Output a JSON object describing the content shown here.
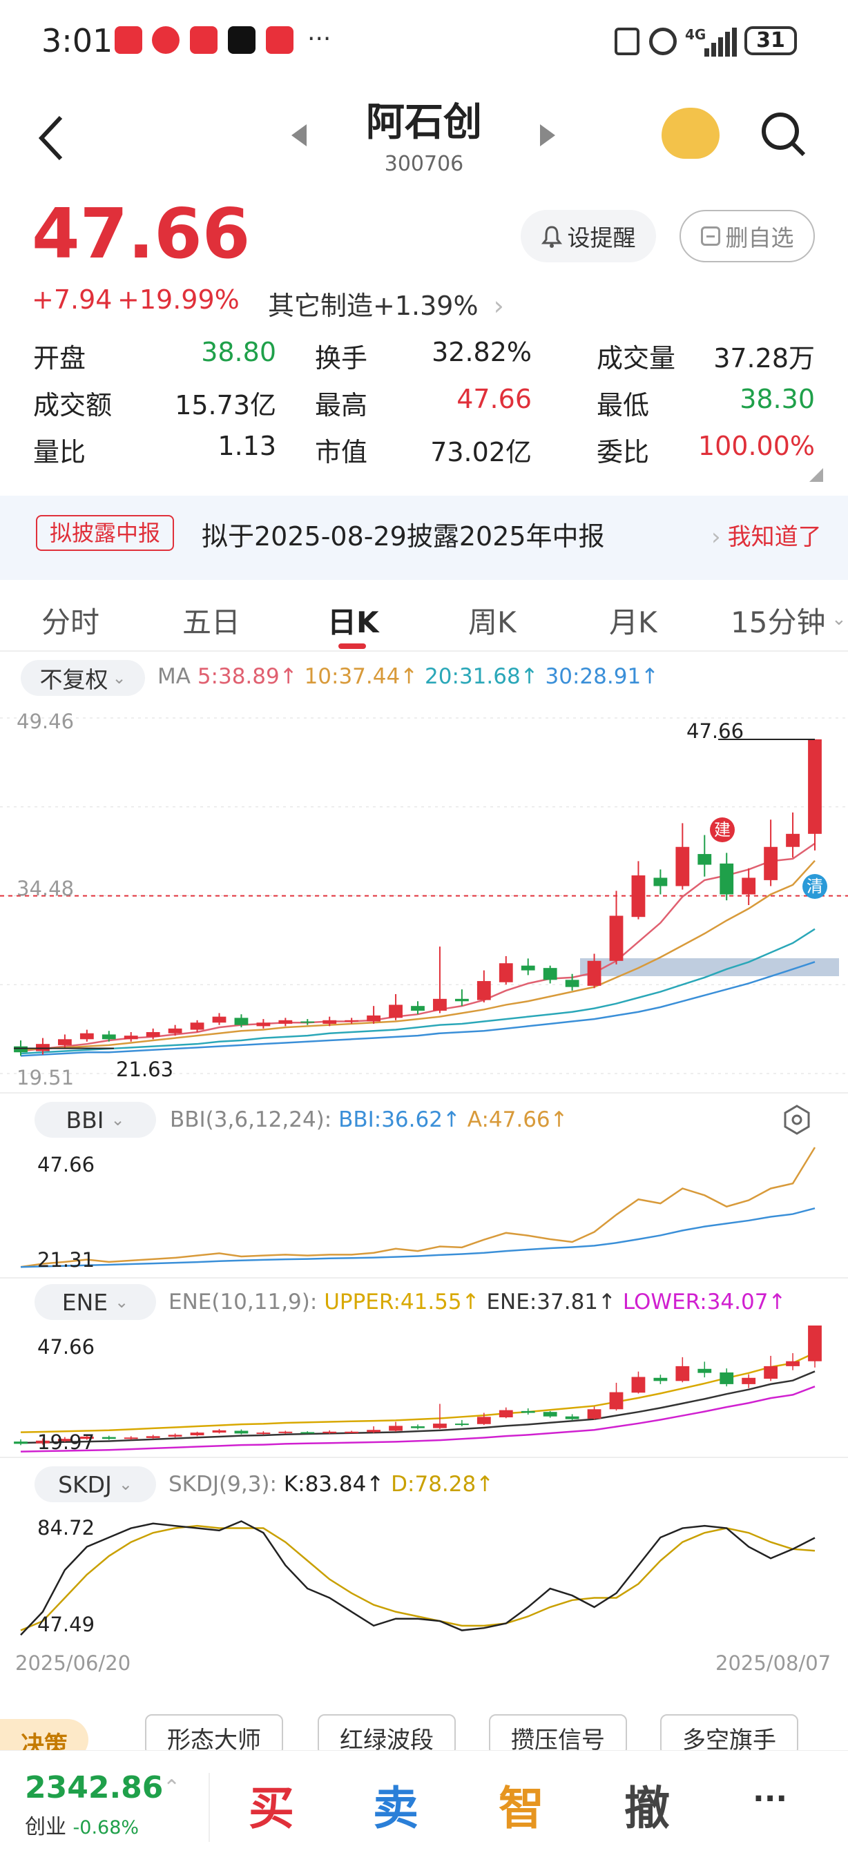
{
  "status_bar": {
    "time": "3:01",
    "battery": "31",
    "network": "4G"
  },
  "header": {
    "title": "阿石创",
    "code": "300706"
  },
  "quote": {
    "price": "47.66",
    "change": "+7.94",
    "change_pct": "+19.99%",
    "sector": "其它制造+1.39%",
    "alert_label": "设提醒",
    "remove_label": "删自选"
  },
  "stats": [
    {
      "label": "开盘",
      "value": "38.80",
      "color": "green"
    },
    {
      "label": "换手",
      "value": "32.82%",
      "color": "black"
    },
    {
      "label": "成交量",
      "value": "37.28万",
      "color": "black"
    },
    {
      "label": "成交额",
      "value": "15.73亿",
      "color": "black"
    },
    {
      "label": "最高",
      "value": "47.66",
      "color": "red"
    },
    {
      "label": "最低",
      "value": "38.30",
      "color": "green"
    },
    {
      "label": "量比",
      "value": "1.13",
      "color": "black"
    },
    {
      "label": "市值",
      "value": "73.02亿",
      "color": "black"
    },
    {
      "label": "委比",
      "value": "100.00%",
      "color": "red"
    }
  ],
  "notice": {
    "badge": "拟披露中报",
    "text": "拟于2025-08-29披露2025年中报",
    "action": "我知道了"
  },
  "tabs": [
    "分时",
    "五日",
    "日K",
    "周K",
    "月K",
    "15分钟"
  ],
  "active_tab": "日K",
  "kline": {
    "adjust": "不复权",
    "ma_label": "MA",
    "ma5": "5:38.89↑",
    "ma10": "10:37.44↑",
    "ma20": "20:31.68↑",
    "ma30": "30:28.91↑",
    "y_top": "49.46",
    "y_mid": "34.48",
    "y_bottom": "19.51",
    "max_label": "47.66",
    "min_label": "21.63",
    "marker_jian": "建",
    "marker_qing": "清"
  },
  "bbi": {
    "name": "BBI",
    "params": "BBI(3,6,12,24):",
    "bbi": "BBI:36.62↑",
    "a": "A:47.66↑",
    "y_top": "47.66",
    "y_bottom": "21.31"
  },
  "ene": {
    "name": "ENE",
    "params": "ENE(10,11,9):",
    "upper": "UPPER:41.55↑",
    "ene": "ENE:37.81↑",
    "lower": "LOWER:34.07↑",
    "y_top": "47.66",
    "y_bottom": "19.97"
  },
  "skdj": {
    "name": "SKDJ",
    "params": "SKDJ(9,3):",
    "k": "K:83.84↑",
    "d": "D:78.28↑",
    "y_top": "84.72",
    "y_bottom": "47.49"
  },
  "dates": {
    "start": "2025/06/20",
    "end": "2025/08/07"
  },
  "chips": [
    "决策",
    "形态大师",
    "红绿波段",
    "攒压信号",
    "多空旗手"
  ],
  "bottom_bar": {
    "index_value": "2342.86",
    "index_name": "创业",
    "index_change": "-0.68%",
    "buy": "买",
    "sell": "卖",
    "smart": "智",
    "cancel": "撤",
    "more": "···"
  },
  "colors": {
    "up": "#e0303a",
    "down": "#1fa04a",
    "ma5": "#e06070",
    "ma10": "#d89a3a",
    "ma20": "#2aa7b8",
    "ma30": "#3a8fd8"
  },
  "chart_data": {
    "type": "candlestick",
    "x_start": "2025/06/20",
    "x_end": "2025/08/07",
    "ylim": [
      19.51,
      49.46
    ],
    "candles": [
      {
        "o": 21.8,
        "c": 21.3,
        "h": 22.3,
        "l": 21.0
      },
      {
        "o": 21.4,
        "c": 22.0,
        "h": 22.5,
        "l": 21.1
      },
      {
        "o": 21.9,
        "c": 22.4,
        "h": 22.8,
        "l": 21.7
      },
      {
        "o": 22.4,
        "c": 22.9,
        "h": 23.2,
        "l": 22.2
      },
      {
        "o": 22.8,
        "c": 22.4,
        "h": 23.1,
        "l": 22.2
      },
      {
        "o": 22.4,
        "c": 22.7,
        "h": 23.0,
        "l": 22.2
      },
      {
        "o": 22.6,
        "c": 23.0,
        "h": 23.3,
        "l": 22.4
      },
      {
        "o": 22.9,
        "c": 23.3,
        "h": 23.6,
        "l": 22.7
      },
      {
        "o": 23.2,
        "c": 23.8,
        "h": 24.0,
        "l": 23.0
      },
      {
        "o": 23.8,
        "c": 24.3,
        "h": 24.6,
        "l": 23.6
      },
      {
        "o": 24.2,
        "c": 23.6,
        "h": 24.5,
        "l": 23.4
      },
      {
        "o": 23.5,
        "c": 23.8,
        "h": 24.1,
        "l": 23.3
      },
      {
        "o": 23.7,
        "c": 24.0,
        "h": 24.2,
        "l": 23.5
      },
      {
        "o": 23.9,
        "c": 23.8,
        "h": 24.1,
        "l": 23.6
      },
      {
        "o": 23.7,
        "c": 24.0,
        "h": 24.3,
        "l": 23.5
      },
      {
        "o": 23.9,
        "c": 24.0,
        "h": 24.2,
        "l": 23.7
      },
      {
        "o": 23.9,
        "c": 24.4,
        "h": 25.2,
        "l": 23.7
      },
      {
        "o": 24.2,
        "c": 25.3,
        "h": 26.2,
        "l": 24.0
      },
      {
        "o": 25.2,
        "c": 24.8,
        "h": 25.6,
        "l": 24.5
      },
      {
        "o": 24.8,
        "c": 25.8,
        "h": 30.2,
        "l": 24.6
      },
      {
        "o": 25.8,
        "c": 25.6,
        "h": 26.6,
        "l": 25.2
      },
      {
        "o": 25.7,
        "c": 27.3,
        "h": 28.2,
        "l": 25.5
      },
      {
        "o": 27.2,
        "c": 28.8,
        "h": 29.4,
        "l": 27.0
      },
      {
        "o": 28.6,
        "c": 28.2,
        "h": 29.2,
        "l": 27.8
      },
      {
        "o": 28.4,
        "c": 27.4,
        "h": 28.6,
        "l": 27.1
      },
      {
        "o": 27.4,
        "c": 26.8,
        "h": 27.9,
        "l": 26.5
      },
      {
        "o": 26.9,
        "c": 29.0,
        "h": 29.6,
        "l": 26.7
      },
      {
        "o": 29.0,
        "c": 32.8,
        "h": 34.9,
        "l": 28.7
      },
      {
        "o": 32.7,
        "c": 36.2,
        "h": 37.4,
        "l": 32.5
      },
      {
        "o": 36.0,
        "c": 35.3,
        "h": 36.7,
        "l": 34.6
      },
      {
        "o": 35.3,
        "c": 38.6,
        "h": 40.6,
        "l": 35.0
      },
      {
        "o": 38.0,
        "c": 37.1,
        "h": 39.6,
        "l": 36.1
      },
      {
        "o": 37.2,
        "c": 34.6,
        "h": 38.1,
        "l": 34.1
      },
      {
        "o": 34.6,
        "c": 36.0,
        "h": 36.8,
        "l": 33.7
      },
      {
        "o": 35.8,
        "c": 38.6,
        "h": 40.9,
        "l": 35.3
      },
      {
        "o": 38.6,
        "c": 39.7,
        "h": 41.5,
        "l": 37.7
      },
      {
        "o": 39.7,
        "c": 47.66,
        "h": 47.66,
        "l": 38.3
      }
    ],
    "ma": [
      {
        "name": "MA5",
        "values": [
          21.4,
          21.6,
          21.8,
          22.0,
          22.3,
          22.5,
          22.6,
          22.8,
          23.0,
          23.4,
          23.6,
          23.7,
          23.8,
          23.8,
          23.9,
          23.9,
          24.0,
          24.3,
          24.5,
          24.9,
          25.2,
          25.7,
          26.5,
          27.1,
          27.5,
          27.6,
          28.0,
          29.0,
          30.6,
          32.2,
          34.4,
          35.8,
          36.2,
          36.7,
          37.4,
          37.6,
          38.89
        ]
      },
      {
        "name": "MA10",
        "values": [
          21.5,
          21.6,
          21.7,
          21.8,
          21.9,
          22.1,
          22.3,
          22.5,
          22.7,
          22.9,
          23.1,
          23.2,
          23.4,
          23.5,
          23.6,
          23.7,
          23.8,
          23.9,
          24.1,
          24.3,
          24.6,
          24.9,
          25.3,
          25.6,
          26.0,
          26.4,
          26.8,
          27.6,
          28.4,
          29.3,
          30.3,
          31.3,
          32.4,
          33.4,
          34.6,
          35.4,
          37.44
        ]
      },
      {
        "name": "MA20",
        "values": [
          21.2,
          21.3,
          21.4,
          21.5,
          21.6,
          21.7,
          21.8,
          21.9,
          22.0,
          22.2,
          22.3,
          22.5,
          22.6,
          22.7,
          22.9,
          23.0,
          23.1,
          23.2,
          23.4,
          23.6,
          23.7,
          23.9,
          24.1,
          24.3,
          24.5,
          24.7,
          25.0,
          25.4,
          25.9,
          26.4,
          27.0,
          27.6,
          28.3,
          28.9,
          29.7,
          30.5,
          31.68
        ]
      },
      {
        "name": "MA30",
        "values": [
          21.0,
          21.1,
          21.2,
          21.3,
          21.3,
          21.4,
          21.5,
          21.6,
          21.7,
          21.8,
          21.9,
          22.0,
          22.1,
          22.2,
          22.3,
          22.4,
          22.5,
          22.6,
          22.7,
          22.9,
          23.0,
          23.1,
          23.3,
          23.5,
          23.7,
          23.9,
          24.1,
          24.4,
          24.7,
          25.1,
          25.6,
          26.1,
          26.6,
          27.1,
          27.7,
          28.3,
          28.91
        ]
      }
    ]
  }
}
